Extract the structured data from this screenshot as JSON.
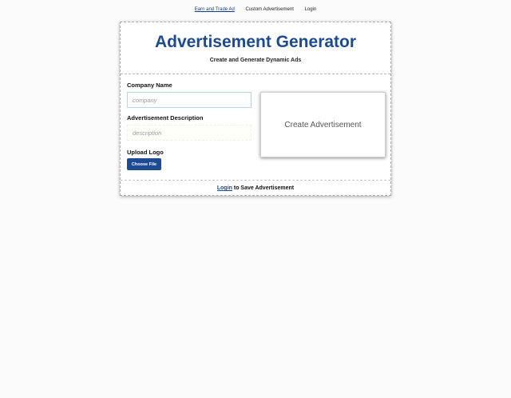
{
  "nav": {
    "items": [
      {
        "label": "Earn and Trade Ad"
      },
      {
        "label": "Custom Advertisement"
      },
      {
        "label": "Login"
      }
    ]
  },
  "header": {
    "title": "Advertisement Generator",
    "subtitle": "Create and Generate Dynamic Ads"
  },
  "form": {
    "company_label": "Company Name",
    "company_placeholder": "company",
    "company_value": "",
    "description_label": "Advertisement Description",
    "description_placeholder": "description",
    "description_value": "",
    "logo_label": "Upload Logo",
    "choose_file_label": "Choose File"
  },
  "preview": {
    "label": "Create Advertisement"
  },
  "footer": {
    "login_link": "Login",
    "text": " to Save Advertisement"
  },
  "colors": {
    "brand": "#1d4b8f",
    "button": "#1c4a93",
    "background": "#fbfbfc"
  }
}
